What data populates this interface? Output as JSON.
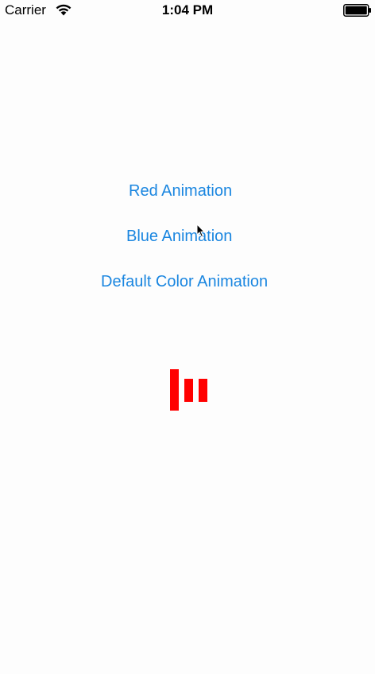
{
  "status_bar": {
    "carrier": "Carrier",
    "time": "1:04 PM",
    "wifi_icon": "wifi-icon",
    "battery_icon": "battery-full-icon"
  },
  "buttons": {
    "red_animation": "Red Animation",
    "blue_animation": "Blue Animation",
    "default_color_animation": "Default Color Animation"
  },
  "loader": {
    "type": "bar-activity-indicator",
    "color": "#ff0000",
    "bar_count": 3
  },
  "colors": {
    "accent": "#1a86e0",
    "background": "#fdfdfd",
    "loader": "#ff0000"
  }
}
